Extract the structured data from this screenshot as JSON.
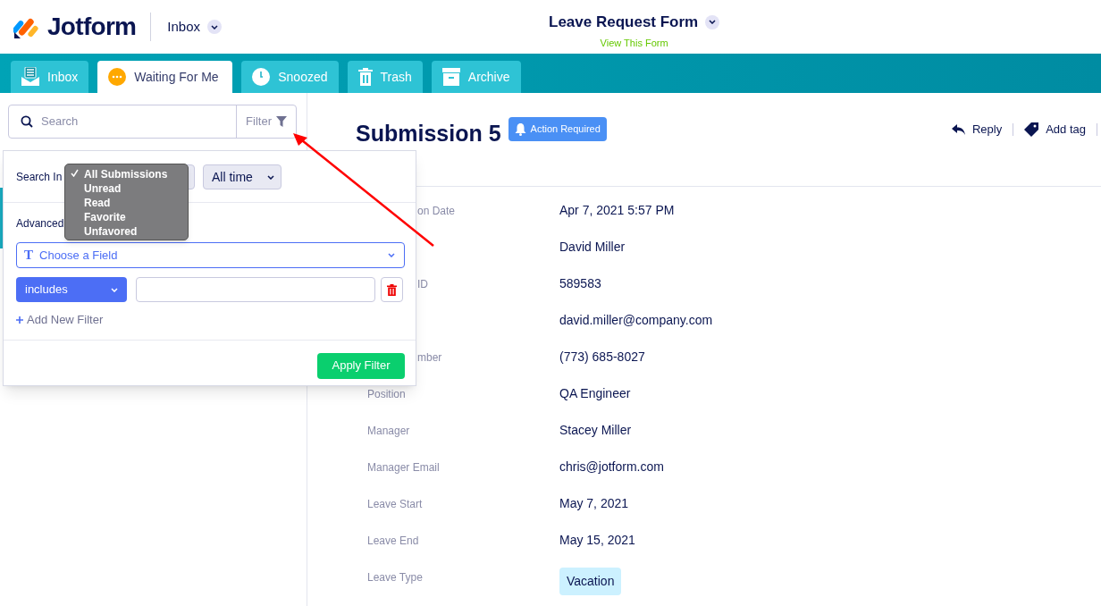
{
  "header": {
    "logo_text": "Jotform",
    "section_menu": "Inbox",
    "form_title": "Leave Request Form",
    "view_link": "View This Form"
  },
  "tabs": [
    {
      "label": "Inbox",
      "kind": "inbox",
      "selected": false
    },
    {
      "label": "Waiting For Me",
      "kind": "waiting",
      "selected": true
    },
    {
      "label": "Snoozed",
      "kind": "clock",
      "selected": false
    },
    {
      "label": "Trash",
      "kind": "trash",
      "selected": false
    },
    {
      "label": "Archive",
      "kind": "archive",
      "selected": false
    }
  ],
  "search": {
    "placeholder": "Search",
    "filter_label": "Filter"
  },
  "filter_panel": {
    "search_in_label": "Search In",
    "search_in_options": [
      {
        "label": "All Submissions",
        "selected": true
      },
      {
        "label": "Unread",
        "selected": false
      },
      {
        "label": "Read",
        "selected": false
      },
      {
        "label": "Favorite",
        "selected": false
      },
      {
        "label": "Unfavored",
        "selected": false
      }
    ],
    "time_select": "All time",
    "advanced_label": "Advanced",
    "field_type_icon": "T",
    "field_select": "Choose a Field",
    "operator": "includes",
    "add_filter": "Add New Filter",
    "apply": "Apply Filter"
  },
  "submission": {
    "title": "Submission 5",
    "badge": "Action Required",
    "actions": [
      {
        "label": "Reply",
        "kind": "reply"
      },
      {
        "label": "Add tag",
        "kind": "tag"
      }
    ],
    "fields": [
      {
        "label": "on Date",
        "partly_hidden": true,
        "value": "Apr 7, 2021 5:57 PM",
        "kind": "text"
      },
      {
        "value": "David Miller",
        "kind": "text"
      },
      {
        "label": "ID",
        "partly_hidden": true,
        "value": "589583",
        "kind": "text"
      },
      {
        "value": "david.miller@company.com",
        "kind": "text"
      },
      {
        "label": "mber",
        "partly_hidden": true,
        "value": "(773) 685-8027",
        "kind": "text"
      },
      {
        "label": "Position",
        "value": "QA Engineer",
        "kind": "text"
      },
      {
        "label": "Manager",
        "value": "Stacey Miller",
        "kind": "text"
      },
      {
        "label": "Manager Email",
        "value": "chris@jotform.com",
        "kind": "text"
      },
      {
        "label": "Leave Start",
        "value": "May 7, 2021",
        "kind": "text"
      },
      {
        "label": "Leave End",
        "value": "May 15, 2021",
        "kind": "text"
      },
      {
        "label": "Leave Type",
        "value": "Vacation",
        "kind": "tag"
      }
    ]
  }
}
